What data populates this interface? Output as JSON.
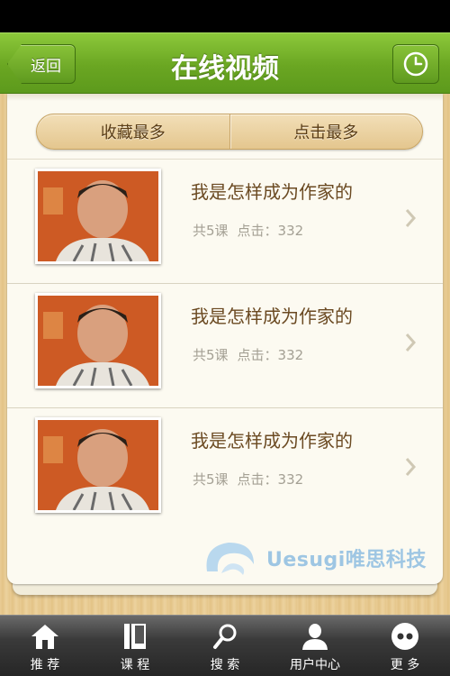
{
  "nav": {
    "back_label": "返回",
    "title": "在线视频",
    "history_icon": "clock-icon"
  },
  "segments": [
    {
      "label": "收藏最多"
    },
    {
      "label": "点击最多"
    }
  ],
  "videos": [
    {
      "title": "我是怎样成为作家的",
      "lessons": "共5课",
      "clicks": "点击：332"
    },
    {
      "title": "我是怎样成为作家的",
      "lessons": "共5课",
      "clicks": "点击：332"
    },
    {
      "title": "我是怎样成为作家的",
      "lessons": "共5课",
      "clicks": "点击：332"
    }
  ],
  "watermark": {
    "text": "Uesugi唯思科技"
  },
  "tabs": [
    {
      "label": "推 荐",
      "icon": "home-icon"
    },
    {
      "label": "课 程",
      "icon": "book-icon"
    },
    {
      "label": "搜 索",
      "icon": "search-icon"
    },
    {
      "label": "用户中心",
      "icon": "user-icon"
    },
    {
      "label": "更 多",
      "icon": "more-icon"
    }
  ],
  "colors": {
    "nav_green": "#6aa622",
    "title_brown": "#6b4a22",
    "meta_gray": "#a4a094",
    "watermark_blue": "#9ec6e3"
  }
}
